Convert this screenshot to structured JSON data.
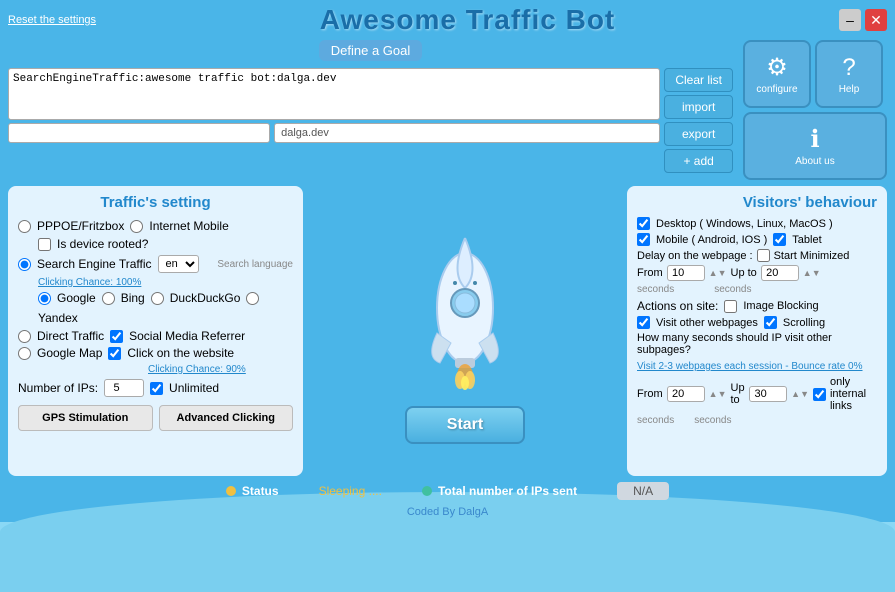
{
  "app": {
    "title": "Awesome Traffic Bot",
    "reset_label": "Reset the settings",
    "coded_by": "Coded By DalgA"
  },
  "window_controls": {
    "minimize_label": "–",
    "close_label": "✕"
  },
  "goal_section": {
    "define_label": "Define a Goal",
    "textarea_value": "SearchEngineTraffic:awesome traffic bot:dalga.dev",
    "domain_value": "dalga.dev",
    "clear_label": "Clear list",
    "import_label": "import",
    "export_label": "export",
    "add_label": "+ add"
  },
  "right_buttons": {
    "configure_label": "configure",
    "configure_icon": "⚙",
    "help_label": "Help",
    "help_icon": "?",
    "about_icon": "ℹ",
    "about_label": "About us"
  },
  "traffic": {
    "title": "Traffic's setting",
    "options": {
      "pppoe": "PPPOE/Fritzbox",
      "internet_mobile": "Internet Mobile",
      "is_device_rooted": "Is device rooted?",
      "search_engine": "Search Engine Traffic",
      "clicking_chance": "Clicking Chance: 100%",
      "lang_value": "en",
      "search_lang": "Search language",
      "google": "Google",
      "bing": "Bing",
      "duckduckgo": "DuckDuckGo",
      "yandex": "Yandex",
      "direct": "Direct Traffic",
      "social_media": "Social Media Referrer",
      "google_map": "Google Map",
      "click_website": "Click on the website",
      "clicking_chance2": "Clicking Chance: 90%",
      "num_ips_label": "Number of IPs:",
      "num_ips_value": "5",
      "unlimited": "Unlimited"
    }
  },
  "buttons": {
    "gps": "GPS Stimulation",
    "advanced": "Advanced Clicking",
    "start": "Start"
  },
  "visitors": {
    "title": "Visitors' behaviour",
    "desktop": "Desktop ( Windows, Linux, MacOS )",
    "mobile": "Mobile ( Android, IOS )",
    "tablet": "Tablet",
    "delay_label": "Delay on the webpage :",
    "start_minimized": "Start Minimized",
    "from_label": "From",
    "from_value": "10",
    "up_to_label": "Up to",
    "up_to_value": "20",
    "seconds_label": "seconds",
    "actions_label": "Actions on site:",
    "image_blocking": "Image Blocking",
    "visit_webpages": "Visit other webpages",
    "scrolling": "Scrolling",
    "subpages_question": "How many seconds should IP visit other subpages?",
    "visit_link": "Visit 2-3 webpages each session - Bounce rate 0%",
    "from2_value": "20",
    "up_to2_value": "30",
    "only_internal": "only internal links"
  },
  "status": {
    "status_label": "Status",
    "sleeping_text": "Sleeping ....",
    "total_label": "Total number of IPs sent",
    "total_value": "N/A"
  }
}
